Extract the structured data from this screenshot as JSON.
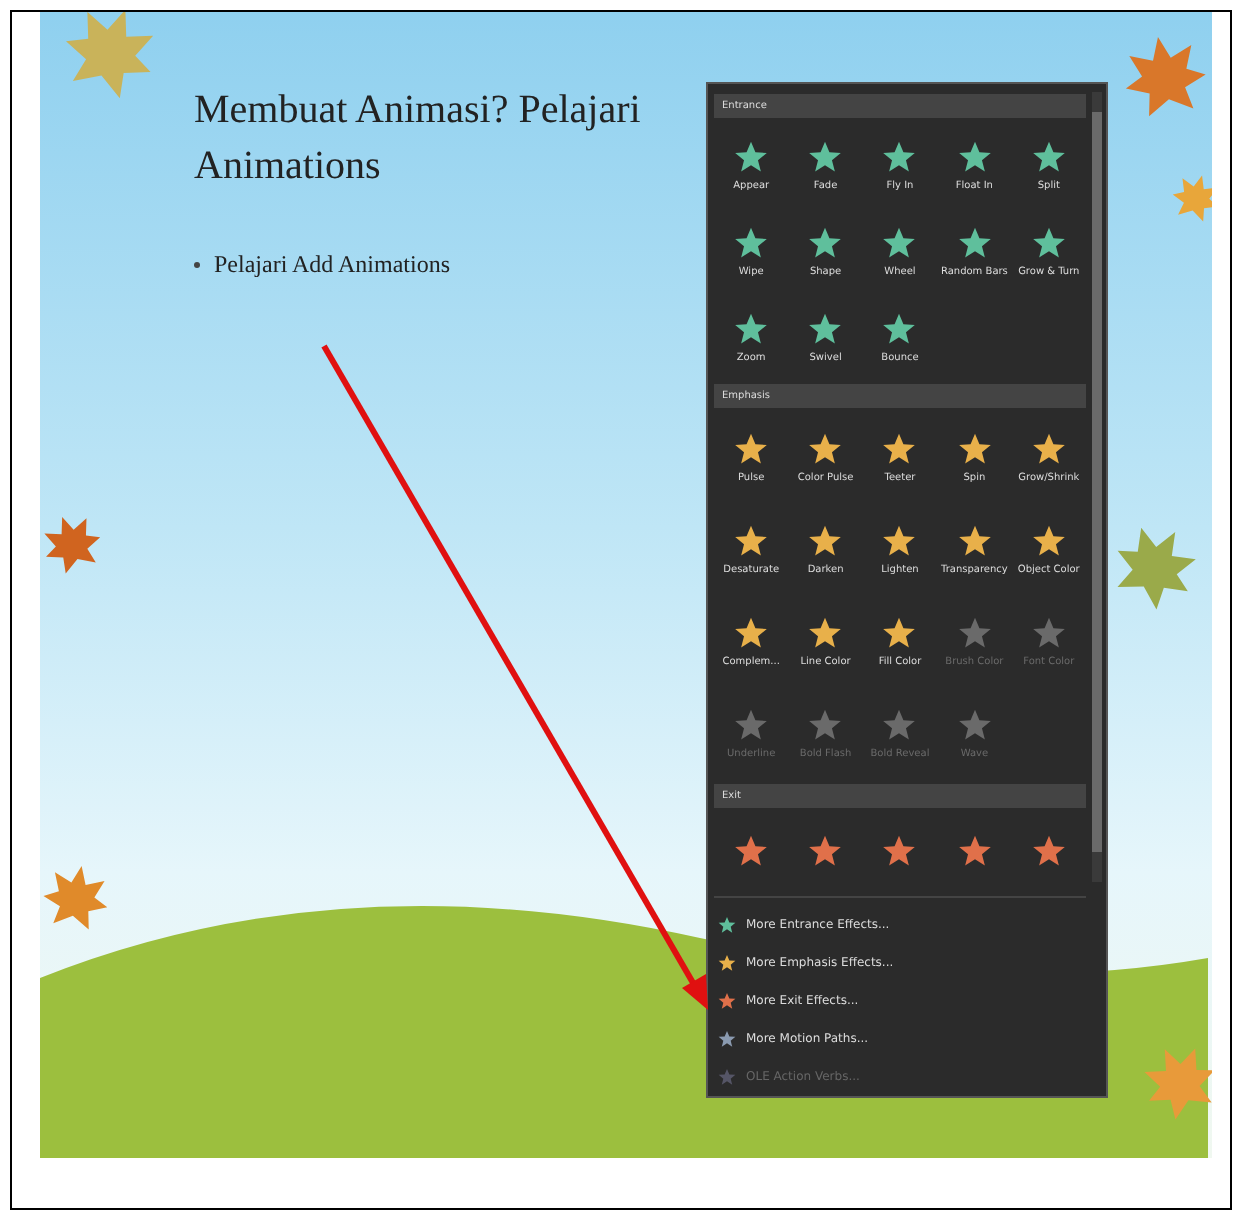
{
  "slide": {
    "title": "Membuat Animasi? Pelajari Animations",
    "bullets": [
      "Pelajari Add Animations"
    ]
  },
  "gallery": {
    "sections": [
      {
        "title": "Entrance",
        "kind": "entrance",
        "effects": [
          {
            "label": "Appear",
            "disabled": false
          },
          {
            "label": "Fade",
            "disabled": false
          },
          {
            "label": "Fly In",
            "disabled": false
          },
          {
            "label": "Float In",
            "disabled": false
          },
          {
            "label": "Split",
            "disabled": false
          },
          {
            "label": "Wipe",
            "disabled": false
          },
          {
            "label": "Shape",
            "disabled": false
          },
          {
            "label": "Wheel",
            "disabled": false
          },
          {
            "label": "Random Bars",
            "disabled": false
          },
          {
            "label": "Grow & Turn",
            "disabled": false
          },
          {
            "label": "Zoom",
            "disabled": false
          },
          {
            "label": "Swivel",
            "disabled": false
          },
          {
            "label": "Bounce",
            "disabled": false
          }
        ]
      },
      {
        "title": "Emphasis",
        "kind": "emphasis",
        "effects": [
          {
            "label": "Pulse",
            "disabled": false
          },
          {
            "label": "Color Pulse",
            "disabled": false
          },
          {
            "label": "Teeter",
            "disabled": false
          },
          {
            "label": "Spin",
            "disabled": false
          },
          {
            "label": "Grow/Shrink",
            "disabled": false
          },
          {
            "label": "Desaturate",
            "disabled": false
          },
          {
            "label": "Darken",
            "disabled": false
          },
          {
            "label": "Lighten",
            "disabled": false
          },
          {
            "label": "Transparency",
            "disabled": false
          },
          {
            "label": "Object Color",
            "disabled": false
          },
          {
            "label": "Complem...",
            "disabled": false
          },
          {
            "label": "Line Color",
            "disabled": false
          },
          {
            "label": "Fill Color",
            "disabled": false
          },
          {
            "label": "Brush Color",
            "disabled": true
          },
          {
            "label": "Font Color",
            "disabled": true
          },
          {
            "label": "Underline",
            "disabled": true
          },
          {
            "label": "Bold Flash",
            "disabled": true
          },
          {
            "label": "Bold Reveal",
            "disabled": true
          },
          {
            "label": "Wave",
            "disabled": true
          }
        ]
      },
      {
        "title": "Exit",
        "kind": "exit",
        "effects": [
          {
            "disabled": false
          },
          {
            "disabled": false
          },
          {
            "disabled": false
          },
          {
            "disabled": false
          },
          {
            "disabled": false
          }
        ]
      }
    ],
    "menu": [
      {
        "label": "More Entrance Effects...",
        "kind": "entrance",
        "disabled": false
      },
      {
        "label": "More Emphasis Effects...",
        "kind": "emphasis",
        "disabled": false
      },
      {
        "label": "More Exit Effects...",
        "kind": "exit",
        "disabled": false
      },
      {
        "label": "More Motion Paths...",
        "kind": "motion",
        "disabled": false
      },
      {
        "label": "OLE Action Verbs...",
        "kind": "ole",
        "disabled": true
      }
    ]
  }
}
